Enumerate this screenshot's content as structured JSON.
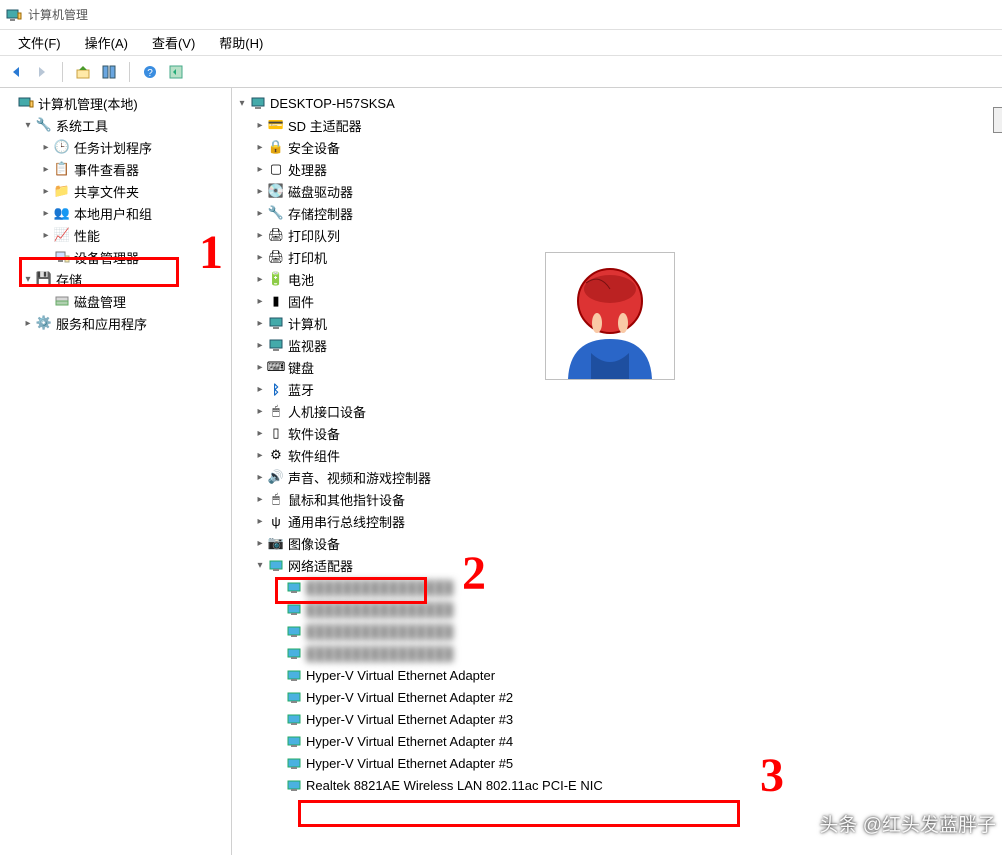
{
  "window": {
    "title": "计算机管理"
  },
  "menu": {
    "file": "文件(F)",
    "action": "操作(A)",
    "view": "查看(V)",
    "help": "帮助(H)"
  },
  "left_tree": {
    "root": "计算机管理(本地)",
    "system_tools": "系统工具",
    "task_scheduler": "任务计划程序",
    "event_viewer": "事件查看器",
    "shared_folders": "共享文件夹",
    "local_users": "本地用户和组",
    "performance": "性能",
    "device_manager": "设备管理器",
    "storage": "存储",
    "disk_mgmt": "磁盘管理",
    "services_apps": "服务和应用程序"
  },
  "device_tree": {
    "root": "DESKTOP-H57SKSA",
    "sd_host": "SD 主适配器",
    "security_devices": "安全设备",
    "processors": "处理器",
    "disk_drives": "磁盘驱动器",
    "storage_controllers": "存储控制器",
    "print_queues": "打印队列",
    "printers": "打印机",
    "batteries": "电池",
    "firmware": "固件",
    "computer": "计算机",
    "monitors": "监视器",
    "keyboards": "键盘",
    "bluetooth": "蓝牙",
    "hid": "人机接口设备",
    "software_devices": "软件设备",
    "software_components": "软件组件",
    "sound": "声音、视频和游戏控制器",
    "mice": "鼠标和其他指针设备",
    "usb": "通用串行总线控制器",
    "imaging": "图像设备",
    "network_adapters": "网络适配器",
    "na_items": [
      "",
      "",
      "",
      "",
      "Hyper-V Virtual Ethernet Adapter",
      "Hyper-V Virtual Ethernet Adapter #2",
      "Hyper-V Virtual Ethernet Adapter #3",
      "Hyper-V Virtual Ethernet Adapter #4",
      "Hyper-V Virtual Ethernet Adapter #5",
      "Realtek 8821AE Wireless LAN 802.11ac PCI-E NIC"
    ]
  },
  "annotations": {
    "a1": "1",
    "a2": "2",
    "a3": "3",
    "watermark": "头条 @红头发蓝胖子"
  }
}
